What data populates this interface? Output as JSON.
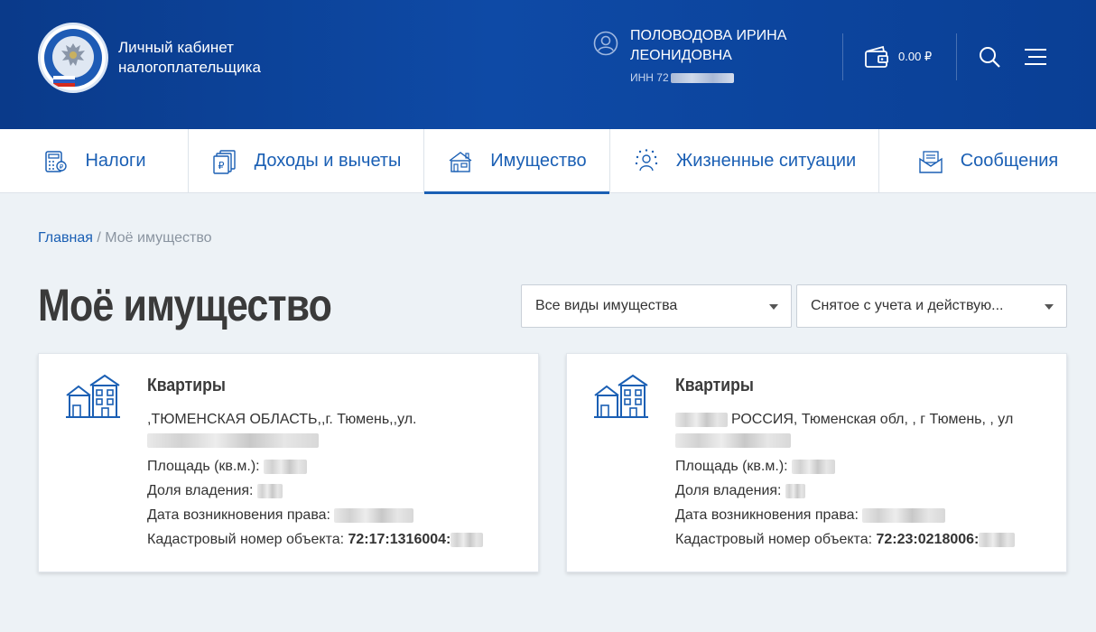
{
  "header": {
    "brand_line1": "Личный кабинет",
    "brand_line2": "налогоплательщика",
    "user_name_line1": "ПОЛОВОДОВА ИРИНА",
    "user_name_line2": "ЛЕОНИДОВНА",
    "inn_label": "ИНН 72",
    "balance": "0.00 ₽",
    "icons": [
      "fns-logo",
      "user-icon",
      "wallet-icon",
      "search-icon",
      "menu-icon"
    ]
  },
  "nav": {
    "items": [
      {
        "label": "Налоги",
        "icon": "calculator-icon",
        "active": false
      },
      {
        "label": "Доходы и вычеты",
        "icon": "ruble-docs-icon",
        "active": false
      },
      {
        "label": "Имущество",
        "icon": "property-icon",
        "active": true
      },
      {
        "label": "Жизненные ситуации",
        "icon": "people-icon",
        "active": false
      },
      {
        "label": "Сообщения",
        "icon": "envelope-icon",
        "active": false
      }
    ]
  },
  "breadcrumb": {
    "home": "Главная",
    "separator": " / ",
    "current": "Моё имущество"
  },
  "page": {
    "title": "Моё имущество"
  },
  "filters": {
    "type_selected": "Все виды имущества",
    "status_selected": "Снятое с учета и действую..."
  },
  "cards": [
    {
      "type": "Квартиры",
      "address": ",ТЮМЕНСКАЯ ОБЛАСТЬ,,г. Тюмень,,ул.",
      "area_label": "Площадь (кв.м.):",
      "share_label": "Доля владения:",
      "date_label": "Дата возникновения права:",
      "cadastral_label": "Кадастровый номер объекта:",
      "cadastral_value": "72:17:1316004:"
    },
    {
      "type": "Квартиры",
      "address": "РОССИЯ, Тюменская обл, , г Тюмень, , ул",
      "area_label": "Площадь (кв.м.):",
      "share_label": "Доля владения:",
      "date_label": "Дата возникновения права:",
      "cadastral_label": "Кадастровый номер объекта:",
      "cadastral_value": "72:23:0218006:"
    }
  ],
  "colors": {
    "header_bg": "#0e4aa6",
    "accent": "#1a5fb4",
    "page_bg": "#edf2f6"
  }
}
